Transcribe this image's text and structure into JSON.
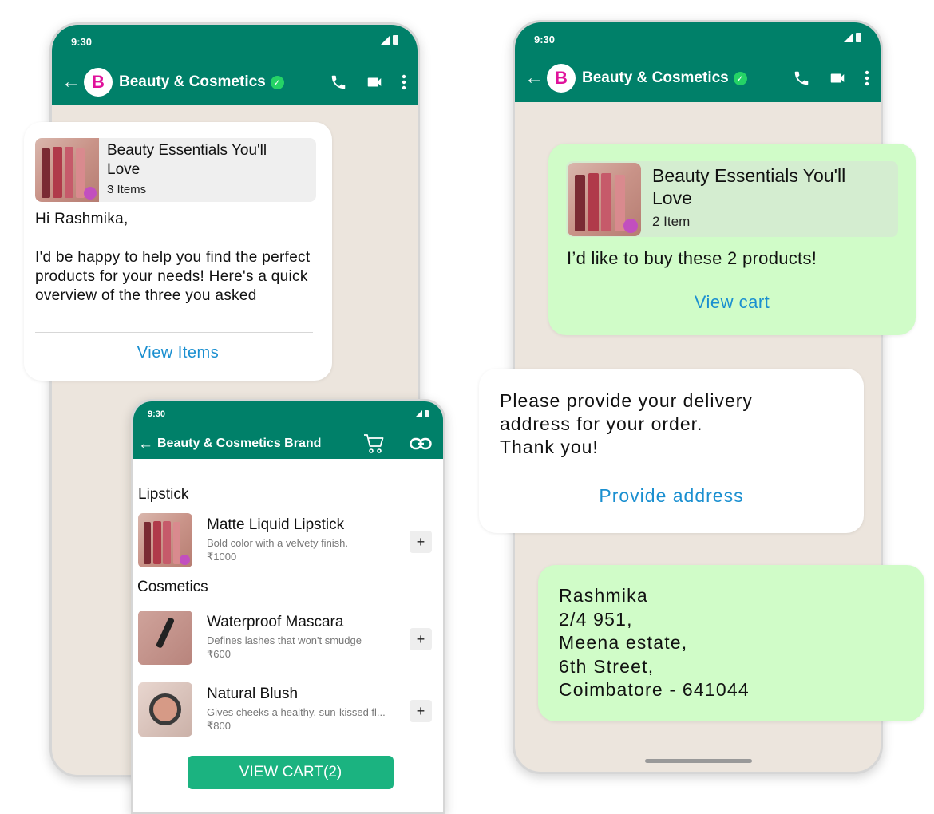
{
  "colors": {
    "header_bg": "#008069",
    "chat_bg": "#ece5dd",
    "incoming_bubble": "#ffffff",
    "outgoing_bubble": "#d0fcc8",
    "link_blue": "#1a8fd0",
    "brand_pink": "#e0119b",
    "verified_green": "#25d366",
    "view_cart_green": "#1bb380"
  },
  "left_phone": {
    "status_time": "9:30",
    "header": {
      "back_icon": "arrow-left-icon",
      "avatar_letter": "B",
      "name": "Beauty & Cosmetics",
      "verified_icon": "verified-check-icon",
      "actions": [
        "phone-icon",
        "video-icon",
        "more-vert-icon"
      ]
    },
    "message": {
      "catalog_title": "Beauty Essentials You'll Love",
      "catalog_count": "3 Items",
      "body": "Hi Rashmika,\n\nI'd be happy to help you find the perfect products for your needs! Here's a quick overview of the three you asked",
      "action_label": "View Items"
    }
  },
  "catalog_screen": {
    "status_time": "9:30",
    "title": "Beauty & Cosmetics Brand",
    "header_icons": [
      "cart-icon",
      "link-icon"
    ],
    "sections": [
      {
        "title": "Lipstick",
        "products": [
          {
            "name": "Matte Liquid Lipstick",
            "description": "Bold color with a velvety finish.",
            "price": "₹1000",
            "add_label": "+"
          }
        ]
      },
      {
        "title": "Cosmetics",
        "products": [
          {
            "name": "Waterproof Mascara",
            "description": "Defines lashes that won't smudge",
            "price": "₹600",
            "add_label": "+"
          },
          {
            "name": "Natural Blush",
            "description": "Gives cheeks a healthy, sun-kissed fl...",
            "price": "₹800",
            "add_label": "+"
          }
        ]
      }
    ],
    "view_cart_label": "VIEW CART(2)"
  },
  "right_phone": {
    "status_time": "9:30",
    "header": {
      "back_icon": "arrow-left-icon",
      "avatar_letter": "B",
      "name": "Beauty & Cosmetics",
      "verified_icon": "verified-check-icon",
      "actions": [
        "phone-icon",
        "video-icon",
        "more-vert-icon"
      ]
    },
    "cart_message": {
      "catalog_title": "Beauty Essentials You'll Love",
      "catalog_count": "2 Item",
      "body": "I’d like to buy these 2 products!",
      "action_label": "View cart"
    },
    "address_request": {
      "body": "Please provide your delivery\naddress for your order.\nThank you!",
      "action_label": "Provide address"
    },
    "address_reply": {
      "body": "Rashmika\n2/4 951,\nMeena estate,\n6th Street,\nCoimbatore - 641044"
    }
  }
}
